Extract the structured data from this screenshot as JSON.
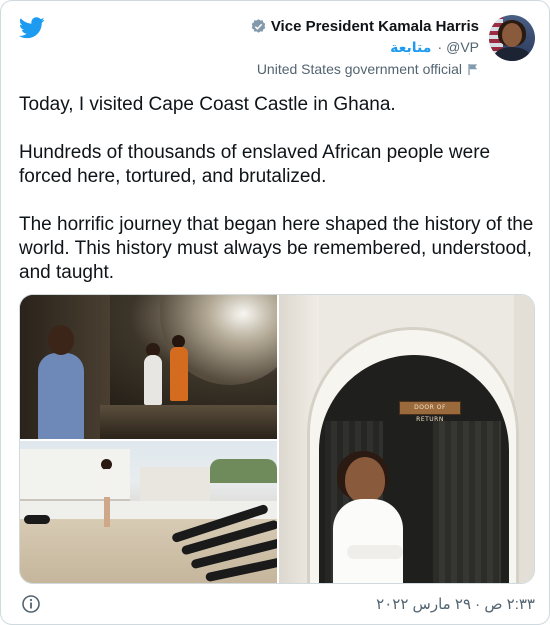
{
  "header": {
    "display_name": "Vice President Kamala Harris",
    "handle": "@VP",
    "separator": "·",
    "follow_label": "متابعة",
    "gov_label": "United States government official"
  },
  "tweet": {
    "paragraphs": [
      "Today, I visited Cape Coast Castle in Ghana.",
      "Hundreds of thousands of enslaved African people were forced here, tortured, and brutalized.",
      "The horrific journey that began here shaped the history of the world. This history must always be remembered, understood, and taught."
    ]
  },
  "media": {
    "door_sign": "DOOR OF RETURN"
  },
  "footer": {
    "timestamp": "٢:٣٣ ص · ٢٩ مارس ٢٠٢٢"
  },
  "colors": {
    "twitter_blue": "#1d9bf0",
    "text_primary": "#0f1419",
    "text_secondary": "#536471",
    "border": "#cfd9de"
  },
  "icons": [
    "twitter-logo-icon",
    "verified-badge-icon",
    "government-flag-icon",
    "info-icon"
  ]
}
